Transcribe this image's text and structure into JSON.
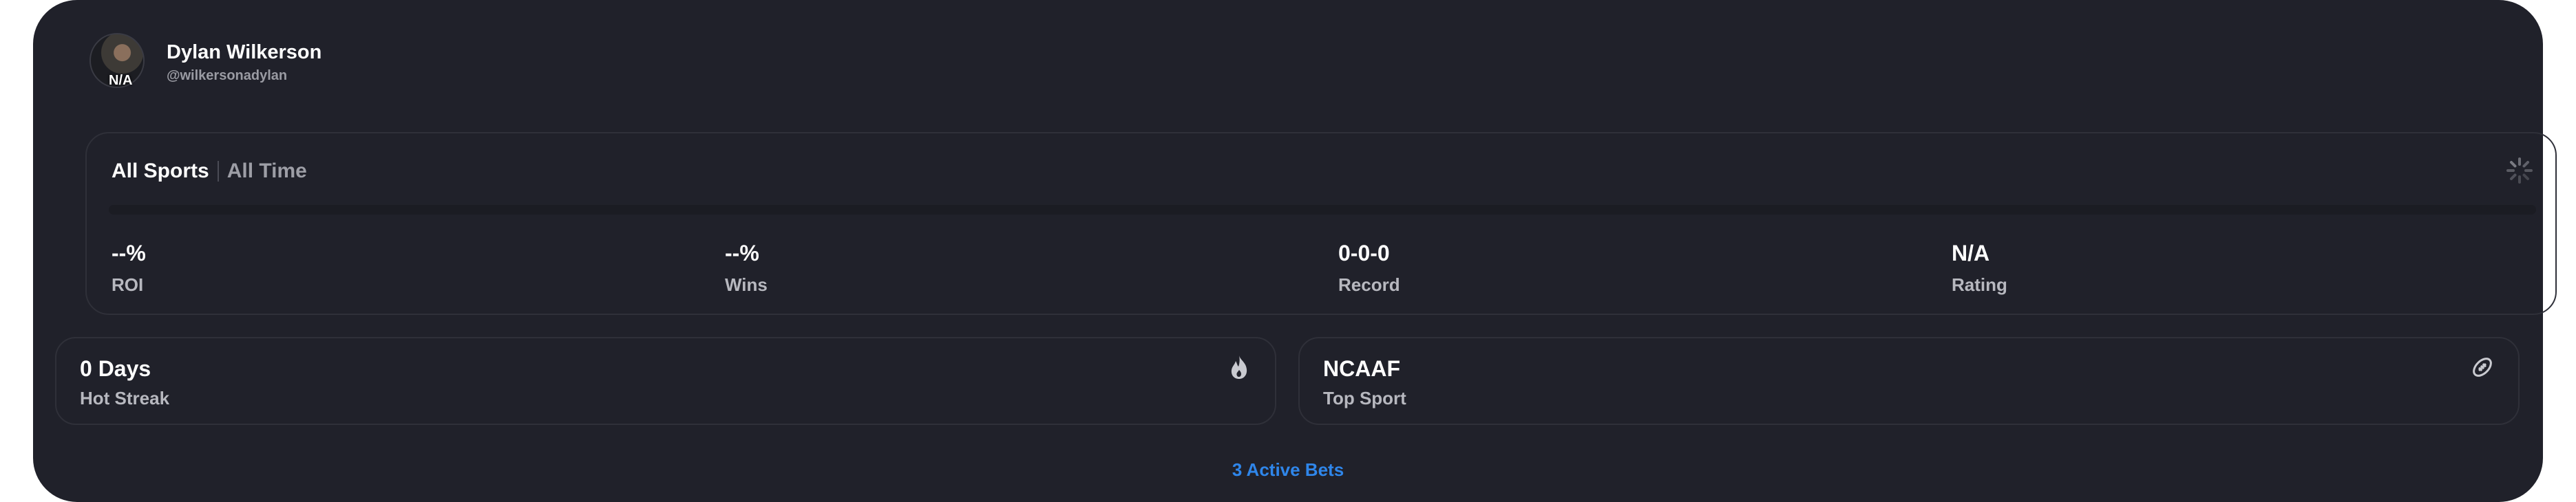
{
  "profile": {
    "name": "Dylan Wilkerson",
    "handle": "@wilkersonadylan",
    "avatar_badge": "N/A"
  },
  "filters": {
    "sport": "All Sports",
    "period": "All Time"
  },
  "stats": [
    {
      "value": "--%",
      "label": "ROI"
    },
    {
      "value": "--%",
      "label": "Wins"
    },
    {
      "value": "0-0-0",
      "label": "Record"
    },
    {
      "value": "N/A",
      "label": "Rating"
    }
  ],
  "hot_streak": {
    "value": "0 Days",
    "label": "Hot Streak",
    "icon": "flame-icon"
  },
  "top_sport": {
    "value": "NCAAF",
    "label": "Top Sport",
    "icon": "football-icon"
  },
  "active_bets": "3 Active Bets",
  "colors": {
    "card_background": "#20212a",
    "border": "#2f3039",
    "link": "#2f86ea",
    "label": "#b7b8bf"
  }
}
